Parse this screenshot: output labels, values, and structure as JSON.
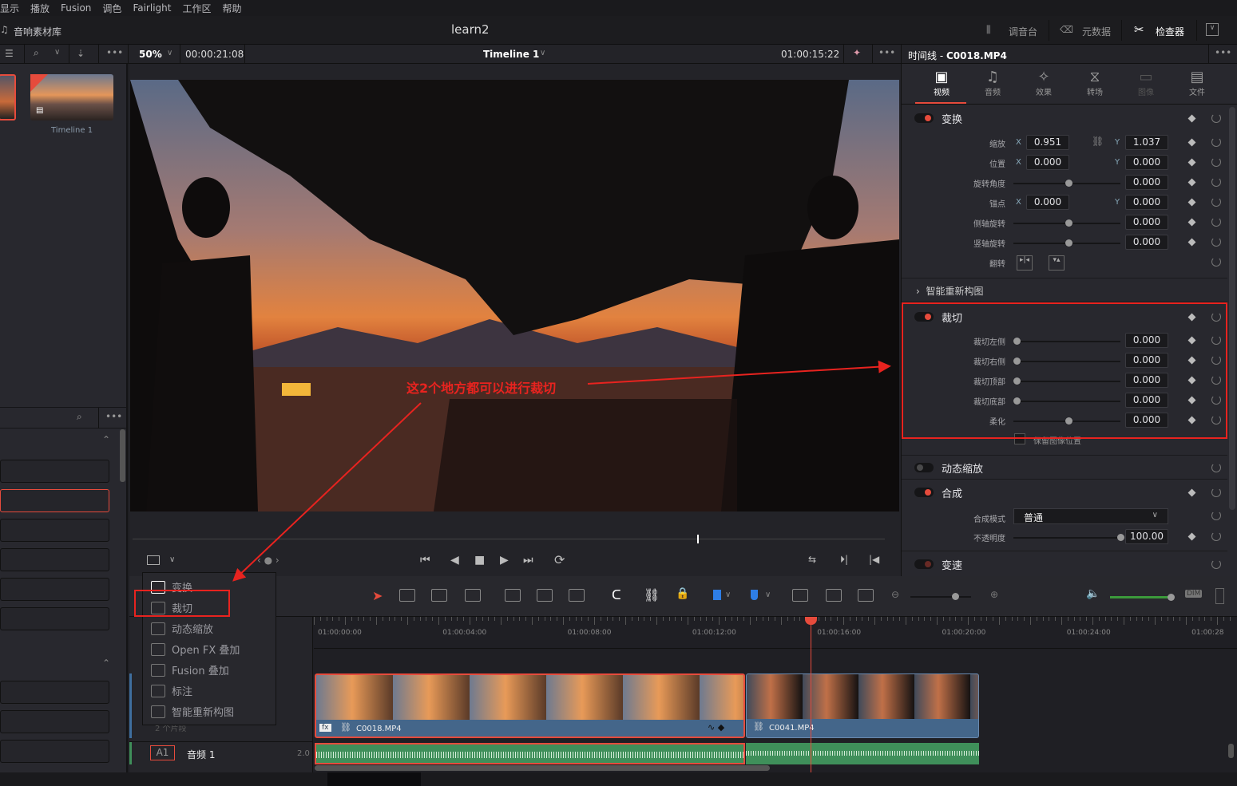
{
  "menu": [
    "显示",
    "播放",
    "Fusion",
    "调色",
    "Fairlight",
    "工作区",
    "帮助"
  ],
  "header": {
    "sound_library": "音响素材库",
    "project_title": "learn2",
    "mixer": "调音台",
    "metadata": "元数据",
    "inspector": "检查器"
  },
  "viewer_toolbar": {
    "zoom": "50%",
    "source_timecode": "00:00:21:08",
    "timeline_name": "Timeline 1",
    "record_timecode": "01:00:15:22",
    "inspector_title_prefix": "时间线 - ",
    "inspector_clip": "C0018.MP4"
  },
  "media_pool": {
    "thumb_label": "Timeline 1"
  },
  "inspector": {
    "tabs": [
      {
        "label": "视频",
        "active": true
      },
      {
        "label": "音频"
      },
      {
        "label": "效果"
      },
      {
        "label": "转场"
      },
      {
        "label": "图像",
        "disabled": true
      },
      {
        "label": "文件"
      }
    ],
    "transform": {
      "title": "变换",
      "zoom_label": "缩放",
      "zoom_x": "0.951",
      "zoom_y": "1.037",
      "position_label": "位置",
      "position_x": "0.000",
      "position_y": "0.000",
      "rotation_label": "旋转角度",
      "rotation": "0.000",
      "anchor_label": "锚点",
      "anchor_x": "0.000",
      "anchor_y": "0.000",
      "pitch_label": "侧轴旋转",
      "pitch": "0.000",
      "yaw_label": "竖轴旋转",
      "yaw": "0.000",
      "flip_label": "翻转",
      "x": "X",
      "y": "Y"
    },
    "smart_reframe": "智能重新构图",
    "crop": {
      "title": "裁切",
      "left_label": "裁切左侧",
      "left": "0.000",
      "right_label": "裁切右侧",
      "right": "0.000",
      "top_label": "裁切顶部",
      "top": "0.000",
      "bottom_label": "裁切底部",
      "bottom": "0.000",
      "soft_label": "柔化",
      "soft": "0.000",
      "retain_label": "保留图像位置"
    },
    "dynamic_zoom": "动态缩放",
    "composite": {
      "title": "合成",
      "mode_label": "合成模式",
      "mode": "普通",
      "opacity_label": "不透明度",
      "opacity": "100.00"
    },
    "speed": "变速"
  },
  "annotation": {
    "text": "这2个地方都可以进行裁切",
    "color": "#e8231f"
  },
  "viewer_menu": {
    "items": [
      "变换",
      "裁切",
      "动态缩放",
      "Open FX 叠加",
      "Fusion 叠加",
      "标注",
      "智能重新构图"
    ]
  },
  "timeline": {
    "ruler": [
      "01:00:00:00",
      "01:00:04:00",
      "01:00:08:00",
      "01:00:12:00",
      "01:00:16:00",
      "01:00:20:00",
      "01:00:24:00",
      "01:00:28"
    ],
    "playhead": "01:00:15:22",
    "clips": [
      {
        "name": "C0018.MP4",
        "fx": "fx"
      },
      {
        "name": "C0041.MP4"
      }
    ],
    "audio_track": {
      "id": "A1",
      "name": "音频 1",
      "channels": "2.0"
    },
    "video_track_hint": "2 个片段",
    "dim": "DIM"
  },
  "colors": {
    "accent": "#e64b3c",
    "clip": "#44668a",
    "audio": "#3f8f5a"
  }
}
